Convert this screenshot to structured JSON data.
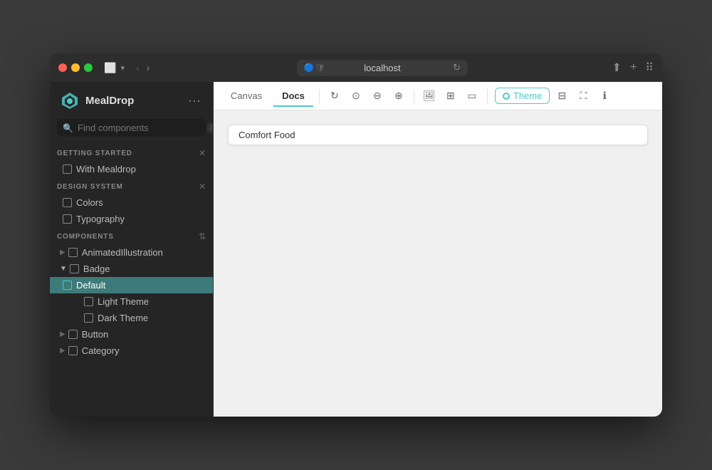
{
  "window": {
    "url": "localhost"
  },
  "logo": {
    "text": "MealDrop"
  },
  "search": {
    "placeholder": "Find components",
    "shortcut": "/"
  },
  "sections": {
    "getting_started": {
      "title": "GETTING STARTED",
      "items": [
        {
          "label": "With Mealdrop"
        }
      ]
    },
    "design_system": {
      "title": "DESIGN SYSTEM",
      "items": [
        {
          "label": "Colors"
        },
        {
          "label": "Typography"
        }
      ]
    },
    "components": {
      "title": "COMPONENTS",
      "items": [
        {
          "label": "AnimatedIllustration",
          "has_arrow": true
        },
        {
          "label": "Badge",
          "expanded": true
        },
        {
          "label": "Default",
          "selected": true,
          "sub": true
        },
        {
          "label": "Light Theme",
          "sub2": true
        },
        {
          "label": "Dark Theme",
          "sub2": true
        },
        {
          "label": "Button",
          "has_arrow": true
        },
        {
          "label": "Category",
          "has_arrow": true
        }
      ]
    }
  },
  "toolbar": {
    "tabs": [
      {
        "label": "Canvas",
        "active": false
      },
      {
        "label": "Docs",
        "active": true
      }
    ],
    "theme_label": "Theme"
  },
  "canvas": {
    "badge_label": "Comfort Food"
  }
}
